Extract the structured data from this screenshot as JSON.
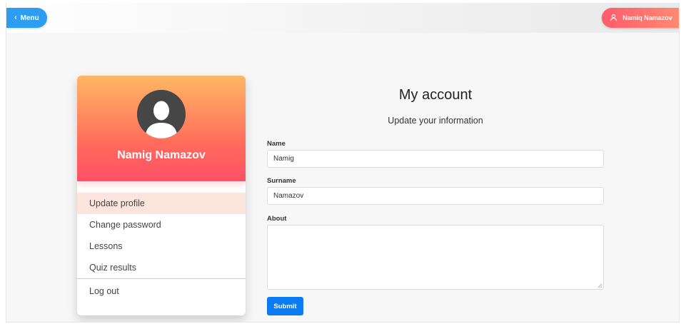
{
  "topbar": {
    "menu_label": "Menu",
    "user_label": "Namiq Namazov"
  },
  "profile": {
    "name": "Namig Namazov",
    "menu": [
      {
        "label": "Update profile",
        "active": true
      },
      {
        "label": "Change password",
        "active": false
      },
      {
        "label": "Lessons",
        "active": false
      },
      {
        "label": "Quiz results",
        "active": false
      }
    ],
    "logout_label": "Log out"
  },
  "form": {
    "title": "My account",
    "subtitle": "Update your information",
    "name_label": "Name",
    "name_value": "Namig",
    "surname_label": "Surname",
    "surname_value": "Namazov",
    "about_label": "About",
    "about_value": "",
    "submit_label": "Submit"
  },
  "colors": {
    "menu_button": "#2d9df2",
    "user_button": "#ff6a6e",
    "card_gradient_top": "#ffb765",
    "card_gradient_bottom": "#ff4f67",
    "active_item": "#fde4dc",
    "submit": "#0b7bf3"
  },
  "icons": {
    "menu_chevron": "chevron-left-icon",
    "user": "user-icon",
    "avatar": "avatar-silhouette"
  }
}
